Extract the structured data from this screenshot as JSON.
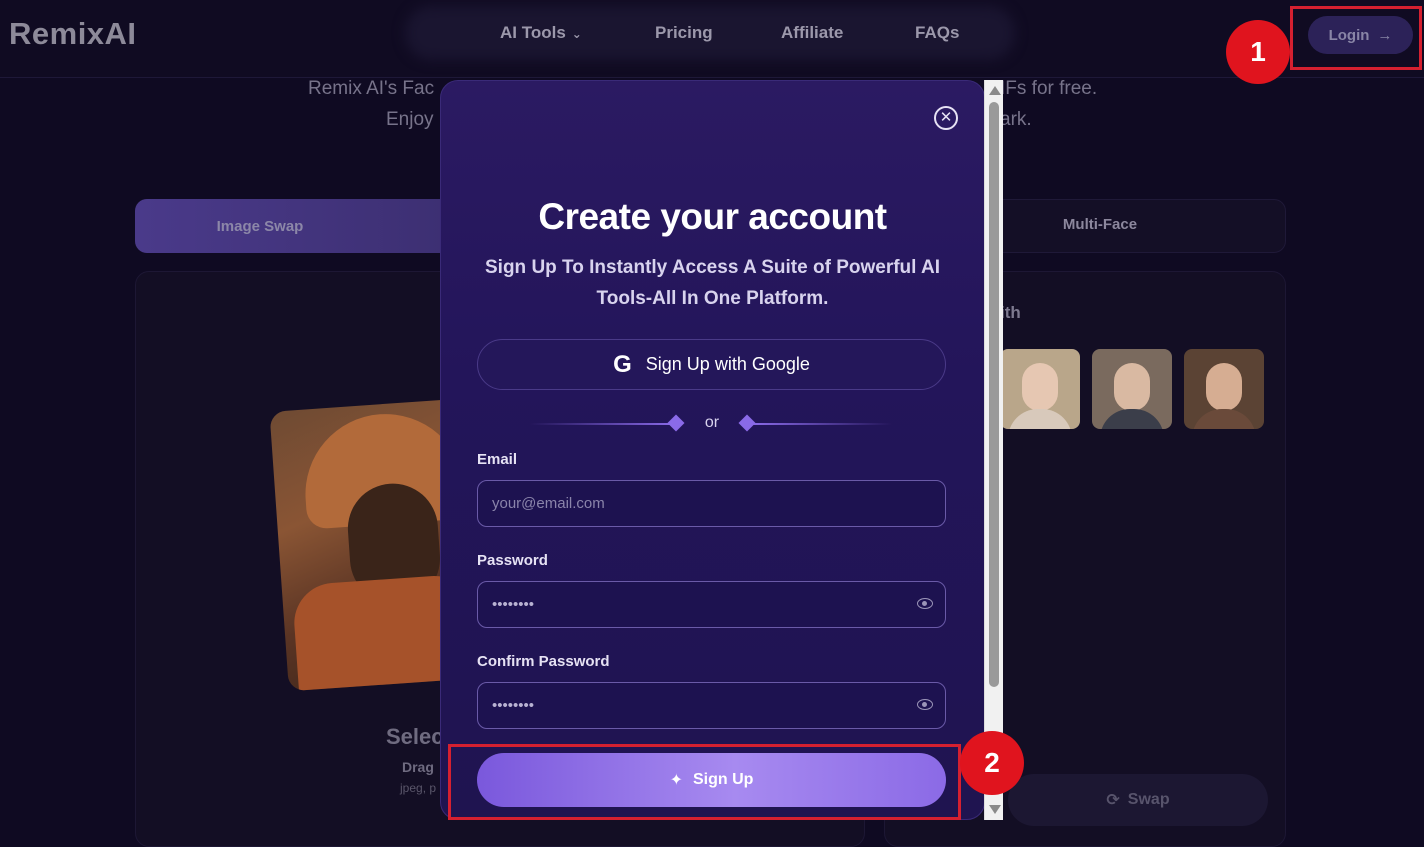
{
  "header": {
    "logo": "RemixAI",
    "nav": [
      {
        "label": "AI Tools"
      },
      {
        "label": "Pricing"
      },
      {
        "label": "Affiliate"
      },
      {
        "label": "FAQs"
      }
    ],
    "login_label": "Login"
  },
  "callouts": {
    "one": "1",
    "two": "2"
  },
  "background": {
    "hero_line1_left": "Remix AI's Fac",
    "hero_line1_right": "IFs for free.",
    "hero_line2_left": "Enjoy",
    "hero_line2_right": "ark.",
    "tab_image_swap": "Image Swap",
    "tab_multi_face": "Multi-Face",
    "panel_with": "ith",
    "select_text": "Selec",
    "drag_text": "Drag",
    "types_text": "jpeg, p",
    "swap_label": "Swap"
  },
  "modal": {
    "title": "Create your account",
    "subtitle": "Sign Up To Instantly Access A Suite of Powerful AI Tools-All In One Platform.",
    "google_label": "Sign Up with Google",
    "or_text": "or",
    "email_label": "Email",
    "email_placeholder": "your@email.com",
    "password_label": "Password",
    "password_value": "••••••••",
    "confirm_label": "Confirm Password",
    "confirm_value": "••••••••",
    "signup_label": "Sign Up"
  },
  "colors": {
    "accent": "#8b6ae6",
    "modal_bg": "#23155a",
    "callout_red": "#e0141e"
  }
}
